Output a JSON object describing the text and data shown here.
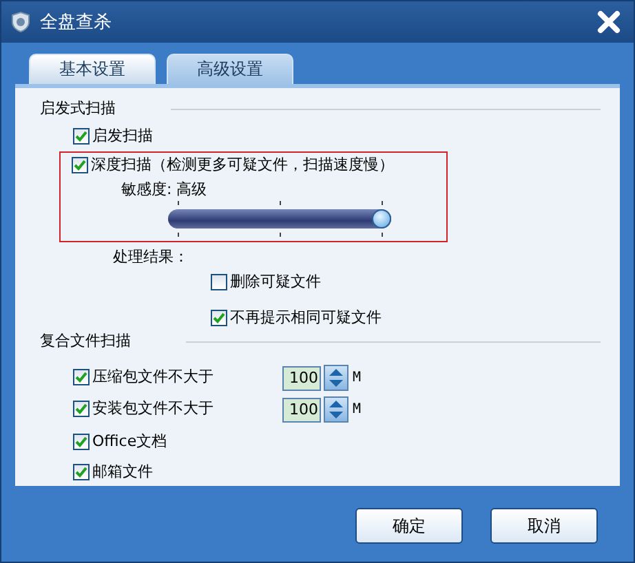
{
  "window": {
    "title": "全盘查杀"
  },
  "tabs": [
    {
      "label": "基本设置",
      "selected": false
    },
    {
      "label": "高级设置",
      "selected": true
    }
  ],
  "heuristic": {
    "heading": "启发式扫描",
    "option": {
      "label": "启发扫描",
      "checked": true
    },
    "deep_scan": {
      "highlighted": true,
      "option": {
        "label": "深度扫描（检测更多可疑文件，扫描速度慢）",
        "checked": true
      },
      "sensitivity": {
        "label": "敏感度: 高级",
        "level": 1
      }
    },
    "result_label": "处理结果：",
    "results": [
      {
        "label": "删除可疑文件",
        "checked": false
      },
      {
        "label": "不再提示相同可疑文件",
        "checked": true
      }
    ]
  },
  "compound": {
    "heading": "复合文件扫描",
    "options": [
      {
        "kind": "limit",
        "label": "压缩包文件不大于",
        "checked": true,
        "value": "100",
        "unit": "M"
      },
      {
        "kind": "limit",
        "label": "安装包文件不大于",
        "checked": true,
        "value": "100",
        "unit": "M"
      },
      {
        "kind": "plain",
        "label": "Office文档",
        "checked": true
      },
      {
        "kind": "plain",
        "label": "邮箱文件",
        "checked": true
      }
    ]
  },
  "buttons": [
    {
      "label": "确定"
    },
    {
      "label": "取消"
    }
  ]
}
